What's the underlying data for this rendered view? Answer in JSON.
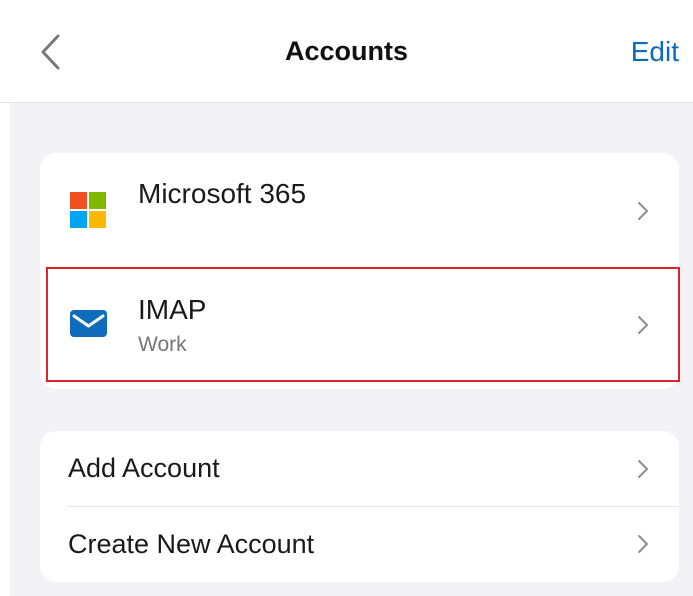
{
  "header": {
    "title": "Accounts",
    "edit_label": "Edit",
    "back_icon": "chevron-left-icon"
  },
  "accounts": [
    {
      "name": "Microsoft 365",
      "subtitle": "",
      "icon": "microsoft-365-logo-icon",
      "colors": [
        "#f25022",
        "#7fba00",
        "#00a4ef",
        "#ffb900"
      ]
    },
    {
      "name": "IMAP",
      "subtitle": "Work",
      "icon": "mail-envelope-icon",
      "color": "#0f6cbd",
      "highlighted": true
    }
  ],
  "actions": [
    {
      "label": "Add Account"
    },
    {
      "label": "Create New Account"
    }
  ],
  "colors": {
    "accent": "#0f6cbd",
    "background": "#f2f2f7",
    "highlight": "#e0202a"
  }
}
